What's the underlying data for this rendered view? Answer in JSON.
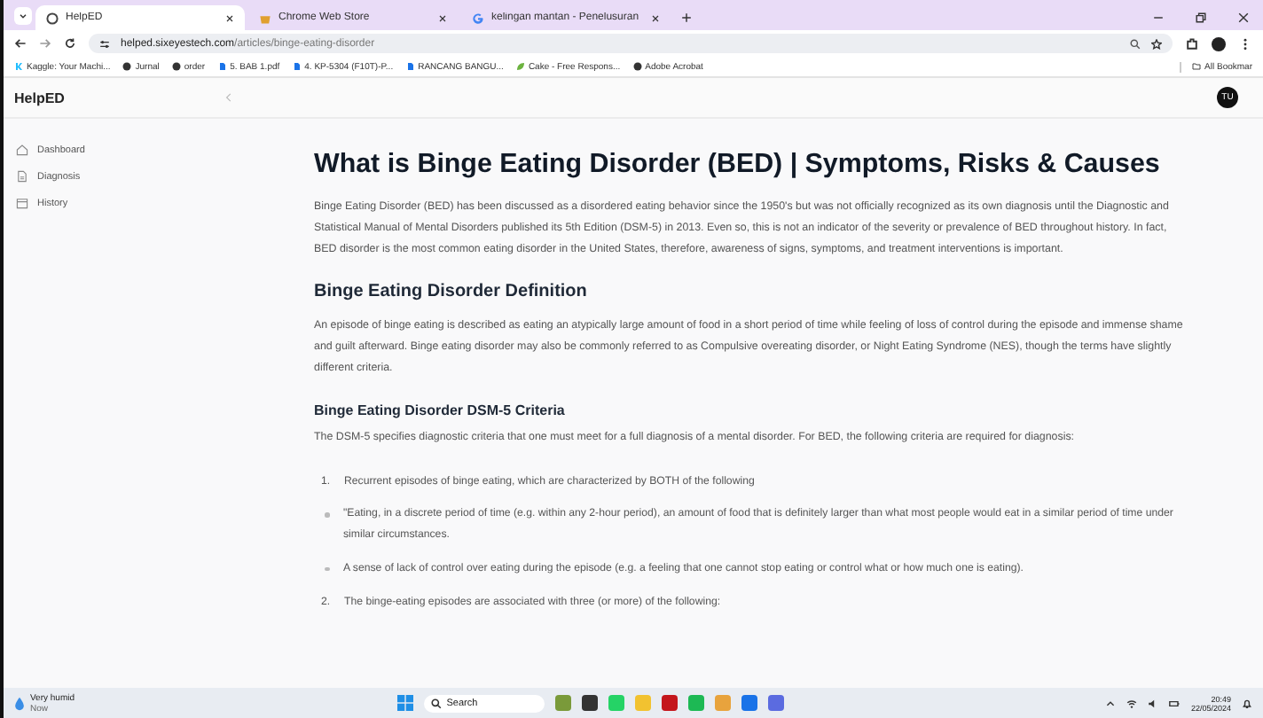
{
  "browser": {
    "tabs": [
      {
        "title": "HelpED",
        "kind": "globe",
        "selected": true
      },
      {
        "title": "Chrome Web Store",
        "kind": "store",
        "selected": false
      },
      {
        "title": "kelingan mantan - Penelusuran",
        "kind": "google",
        "selected": false
      }
    ],
    "url_host": "helped.sixeyestech.com",
    "url_path": "/articles/binge-eating-disorder",
    "bookmarks": [
      {
        "label": "Kaggle: Your Machi...",
        "kind": "kaggle"
      },
      {
        "label": "Jurnal",
        "kind": "globe"
      },
      {
        "label": "order",
        "kind": "globe"
      },
      {
        "label": "5. BAB 1.pdf",
        "kind": "doc"
      },
      {
        "label": "4. KP-5304 (F10T)-P...",
        "kind": "doc"
      },
      {
        "label": "RANCANG BANGU...",
        "kind": "doc"
      },
      {
        "label": "Cake - Free Respons...",
        "kind": "leaf"
      },
      {
        "label": "Adobe Acrobat",
        "kind": "globe"
      }
    ],
    "all_bookmarks": "All Bookmar"
  },
  "app": {
    "brand": "HelpED",
    "avatar": "TU",
    "sidebar": [
      {
        "label": "Dashboard",
        "kind": "home"
      },
      {
        "label": "Diagnosis",
        "kind": "doc"
      },
      {
        "label": "History",
        "kind": "box"
      }
    ]
  },
  "article": {
    "title": "What is Binge Eating Disorder (BED) | Symptoms, Risks & Causes",
    "blocks": [
      {
        "kind": "paragraph",
        "text": "Binge Eating Disorder (BED) has been discussed as a disordered eating behavior since the 1950's but was not officially recognized as its own diagnosis until the Diagnostic and Statistical Manual of Mental Disorders published its 5th Edition (DSM-5) in 2013. Even so, this is not an indicator of the severity or prevalence of BED throughout history. In fact, BED disorder is the most common eating disorder in the United States, therefore, awareness of signs, symptoms, and treatment interventions is important."
      },
      {
        "kind": "h2",
        "text": "Binge Eating Disorder Definition"
      },
      {
        "kind": "paragraph",
        "text": "An episode of binge eating is described as eating an atypically large amount of food in a short period of time while feeling of loss of control during the episode and immense shame and guilt afterward. Binge eating disorder may also be commonly referred to as Compulsive overeating disorder, or Night Eating Syndrome (NES), though the terms have slightly different criteria."
      },
      {
        "kind": "h3",
        "text": "Binge Eating Disorder DSM-5 Criteria"
      },
      {
        "kind": "paragraph",
        "text": "The DSM-5 specifies diagnostic criteria that one must meet for a full diagnosis of a mental disorder. For BED, the following criteria are required for diagnosis:"
      },
      {
        "kind": "numbered",
        "number": "1.",
        "text": "Recurrent episodes of binge eating, which are characterized by BOTH of the following"
      },
      {
        "kind": "bullet",
        "text": "\"Eating, in a discrete period of time (e.g. within any 2-hour period), an amount of food that is definitely larger than what most people would eat in a similar period of time under similar circumstances."
      },
      {
        "kind": "bullet",
        "text": "A sense of lack of control over eating during the episode (e.g. a feeling that one cannot stop eating or control what or how much one is eating)."
      },
      {
        "kind": "numbered",
        "number": "2.",
        "text": "The binge-eating episodes are associated with three (or more) of the following:"
      }
    ]
  },
  "taskbar": {
    "weather": "Very humid",
    "weather_sub": "Now",
    "search": "Search",
    "time": "20:49",
    "date": "22/05/2024"
  }
}
